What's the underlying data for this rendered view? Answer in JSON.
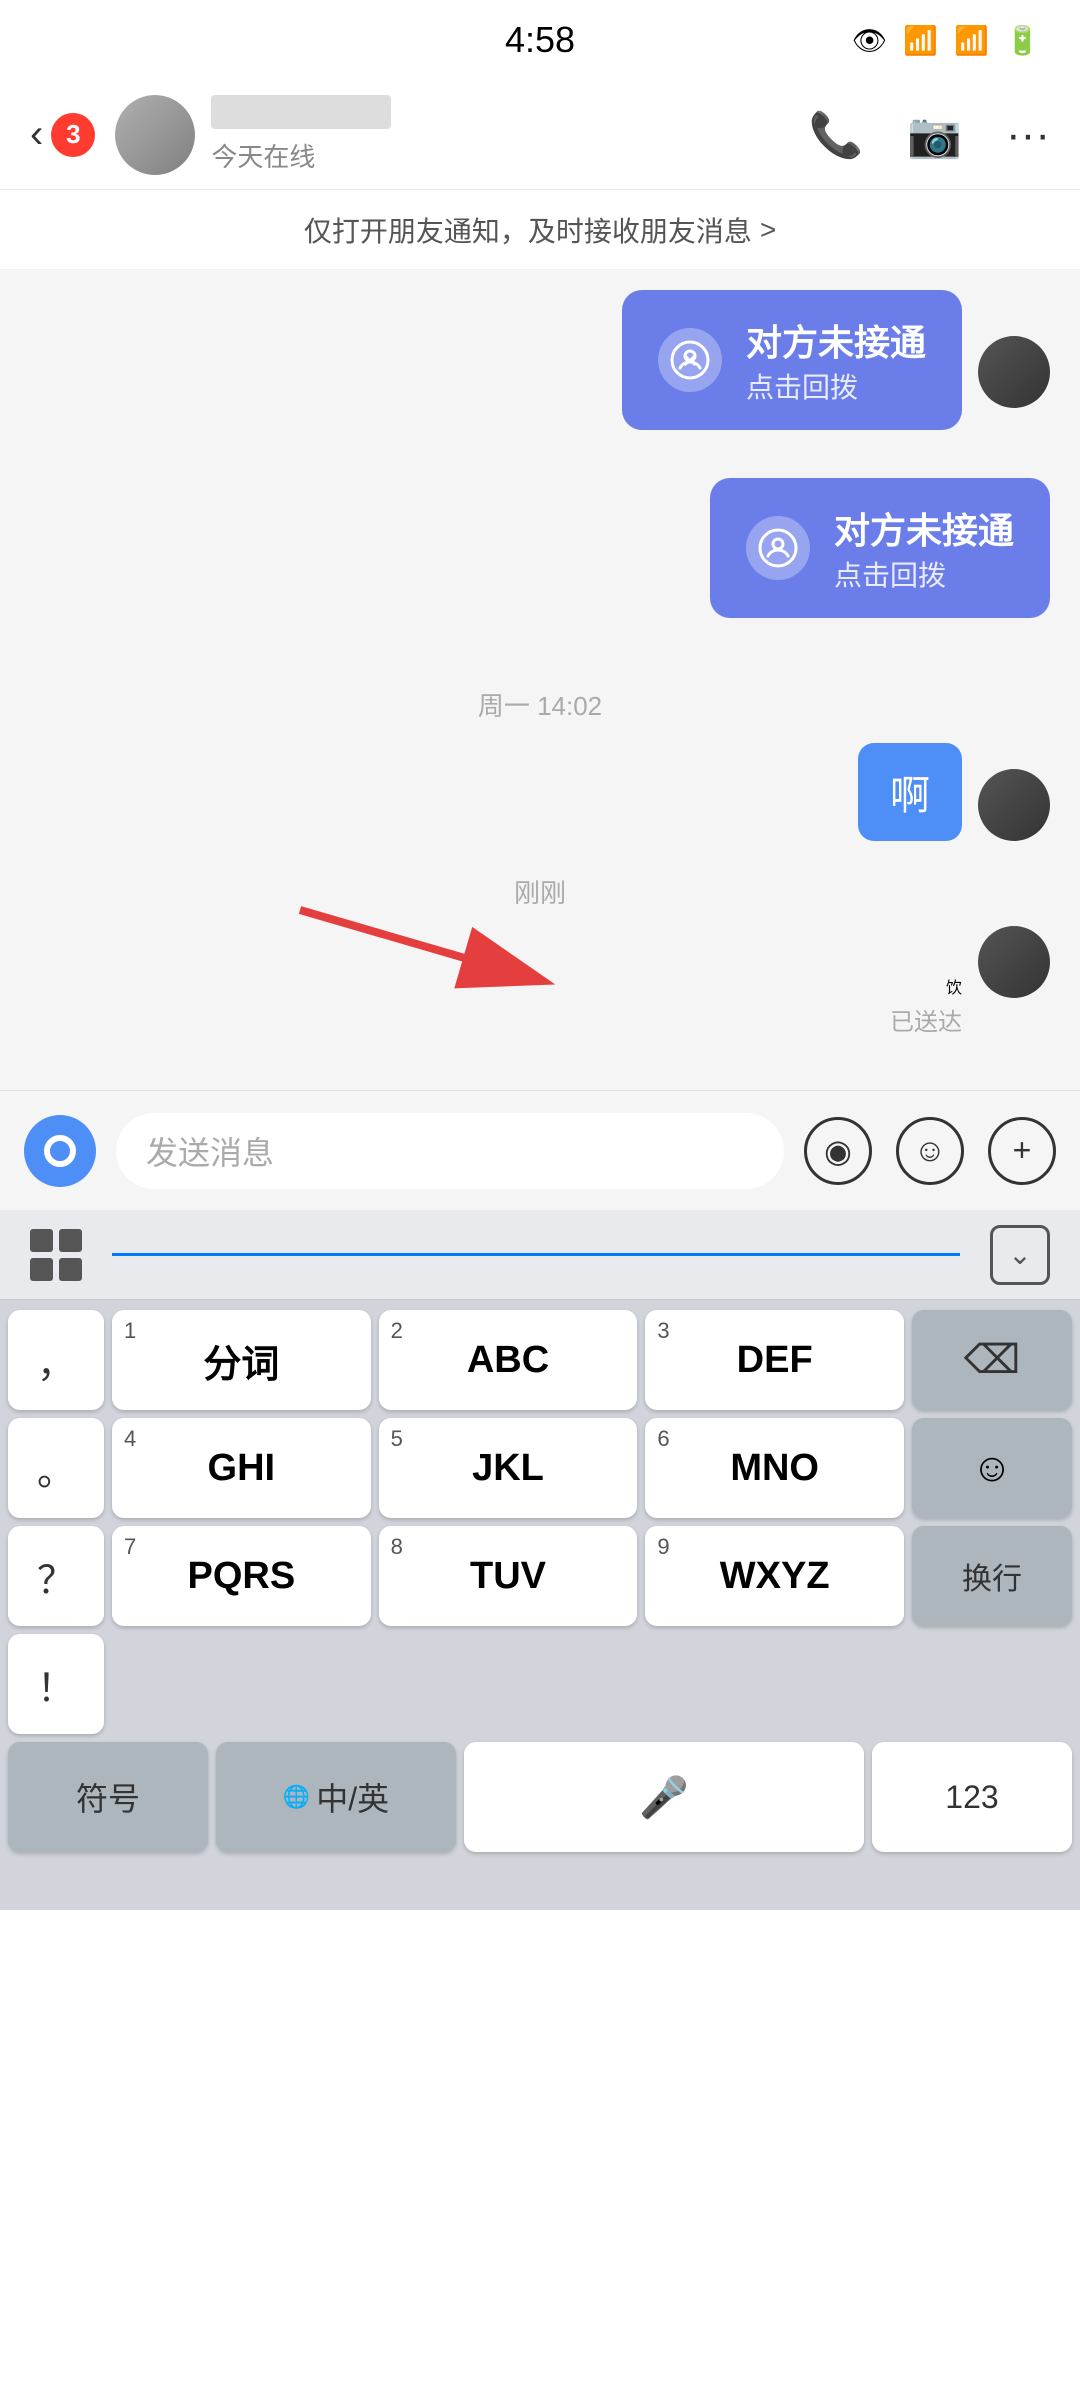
{
  "statusBar": {
    "time": "4:58"
  },
  "header": {
    "backLabel": "<",
    "badgeCount": "3",
    "contactName": "",
    "statusText": "今天在线",
    "phoneIcon": "📞",
    "videoIcon": "📹",
    "moreIcon": "···"
  },
  "notification": {
    "text": "仅打开朋友通知，及时接收朋友消息",
    "arrow": ">"
  },
  "chat": {
    "missedCall1": {
      "title": "对方未接通",
      "subtitle": "点击回拨"
    },
    "missedCall2": {
      "title": "对方未接通",
      "subtitle": "点击回拨"
    },
    "timestamp1": "周一 14:02",
    "msg1": "啊",
    "timestampRecent": "刚刚",
    "msg2": "饮",
    "deliveredLabel": "已送达"
  },
  "inputBar": {
    "placeholder": "发送消息",
    "voiceWaveIcon": "◉",
    "emojiIcon": "☺",
    "addIcon": "+"
  },
  "keyboard": {
    "appsLabel": "apps",
    "hideLabel": "↓",
    "keys": [
      {
        "num": "",
        "label": "'"
      },
      {
        "num": "",
        "label": "。"
      },
      {
        "num": "",
        "label": "？"
      },
      {
        "num": "",
        "label": "！"
      },
      {
        "num": "1",
        "label": "分词"
      },
      {
        "num": "2",
        "label": "ABC"
      },
      {
        "num": "3",
        "label": "DEF"
      },
      {
        "num": "4",
        "label": "GHI"
      },
      {
        "num": "5",
        "label": "JKL"
      },
      {
        "num": "6",
        "label": "MNO"
      },
      {
        "num": "7",
        "label": "PQRS"
      },
      {
        "num": "8",
        "label": "TUV"
      },
      {
        "num": "9",
        "label": "WXYZ"
      }
    ],
    "bottomRow": {
      "symbolLabel": "符号",
      "chineseLabel": "中/英",
      "spaceLabel": "mic",
      "numLabel": "123",
      "enterLabel": "换行"
    }
  }
}
